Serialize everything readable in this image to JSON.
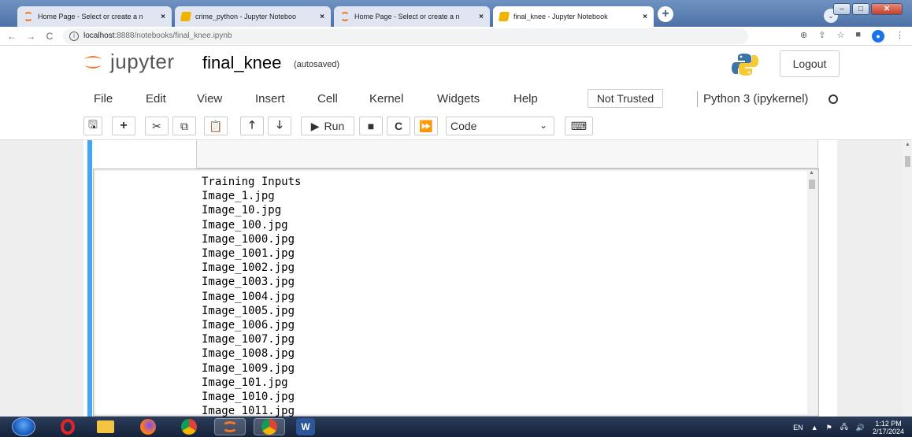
{
  "browser": {
    "tabs": [
      {
        "label": "Home Page - Select or create a n",
        "icon": "jupyter-icon",
        "active": false
      },
      {
        "label": "crime_python - Jupyter Noteboo",
        "icon": "notebook-icon",
        "active": false
      },
      {
        "label": "Home Page - Select or create a n",
        "icon": "jupyter-icon",
        "active": false
      },
      {
        "label": "final_knee - Jupyter Notebook",
        "icon": "notebook-icon",
        "active": true
      }
    ],
    "close_glyph": "×",
    "new_tab_glyph": "+",
    "url_host": "localhost",
    "url_path": ":8888/notebooks/final_knee.ipynb"
  },
  "jupyter": {
    "logo_text": "jupyter",
    "notebook_name": "final_knee",
    "save_status": "(autosaved)",
    "logout_label": "Logout"
  },
  "menu": {
    "items": [
      "File",
      "Edit",
      "View",
      "Insert",
      "Cell",
      "Kernel",
      "Widgets",
      "Help"
    ],
    "trust_label": "Not Trusted",
    "kernel_label": "Python 3 (ipykernel)"
  },
  "toolbar": {
    "run_label": "Run",
    "cell_type": "Code"
  },
  "output": {
    "lines": [
      "Training Inputs",
      "Image_1.jpg",
      "Image_10.jpg",
      "Image_100.jpg",
      "Image_1000.jpg",
      "Image_1001.jpg",
      "Image_1002.jpg",
      "Image_1003.jpg",
      "Image_1004.jpg",
      "Image_1005.jpg",
      "Image_1006.jpg",
      "Image_1007.jpg",
      "Image_1008.jpg",
      "Image_1009.jpg",
      "Image_101.jpg",
      "Image_1010.jpg",
      "Image_1011.jpg"
    ]
  },
  "taskbar": {
    "language": "EN",
    "time": "1:12 PM",
    "date": "2/17/2024"
  },
  "colors": {
    "jupyter_orange": "#f37726",
    "cell_selected": "#42a5f5",
    "tab_strip": "#5b7fb0"
  }
}
